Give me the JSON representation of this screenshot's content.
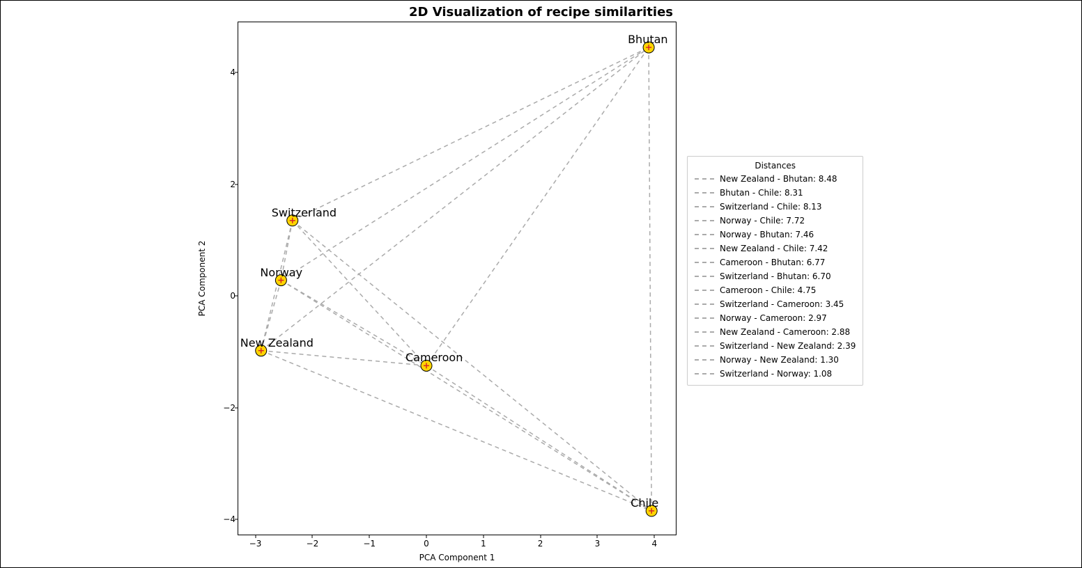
{
  "chart_data": {
    "type": "scatter",
    "title": "2D Visualization of recipe similarities",
    "xlabel": "PCA Component 1",
    "ylabel": "PCA Component 2",
    "xlim": [
      -3.3,
      4.4
    ],
    "ylim": [
      -4.3,
      4.9
    ],
    "x_ticks": [
      -3,
      -2,
      -1,
      0,
      1,
      2,
      3,
      4
    ],
    "y_ticks": [
      -4,
      -2,
      0,
      2,
      4
    ],
    "points": [
      {
        "name": "Switzerland",
        "x": -2.35,
        "y": 1.35
      },
      {
        "name": "Norway",
        "x": -2.55,
        "y": 0.28
      },
      {
        "name": "New Zealand",
        "x": -2.9,
        "y": -0.98
      },
      {
        "name": "Cameroon",
        "x": 0.0,
        "y": -1.25
      },
      {
        "name": "Bhutan",
        "x": 3.9,
        "y": 4.45
      },
      {
        "name": "Chile",
        "x": 3.95,
        "y": -3.85
      }
    ],
    "distances": [
      {
        "pair": "New Zealand - Bhutan",
        "value": 8.48
      },
      {
        "pair": "Bhutan - Chile",
        "value": 8.31
      },
      {
        "pair": "Switzerland - Chile",
        "value": 8.13
      },
      {
        "pair": "Norway - Chile",
        "value": 7.72
      },
      {
        "pair": "Norway - Bhutan",
        "value": 7.46
      },
      {
        "pair": "New Zealand - Chile",
        "value": 7.42
      },
      {
        "pair": "Cameroon - Bhutan",
        "value": 6.77
      },
      {
        "pair": "Switzerland - Bhutan",
        "value": 6.7
      },
      {
        "pair": "Cameroon - Chile",
        "value": 4.75
      },
      {
        "pair": "Switzerland - Cameroon",
        "value": 3.45
      },
      {
        "pair": "Norway - Cameroon",
        "value": 2.97
      },
      {
        "pair": "New Zealand - Cameroon",
        "value": 2.88
      },
      {
        "pair": "Switzerland - New Zealand",
        "value": 2.39
      },
      {
        "pair": "Norway - New Zealand",
        "value": 1.3
      },
      {
        "pair": "Switzerland - Norway",
        "value": 1.08
      }
    ],
    "legend_title": "Distances"
  }
}
